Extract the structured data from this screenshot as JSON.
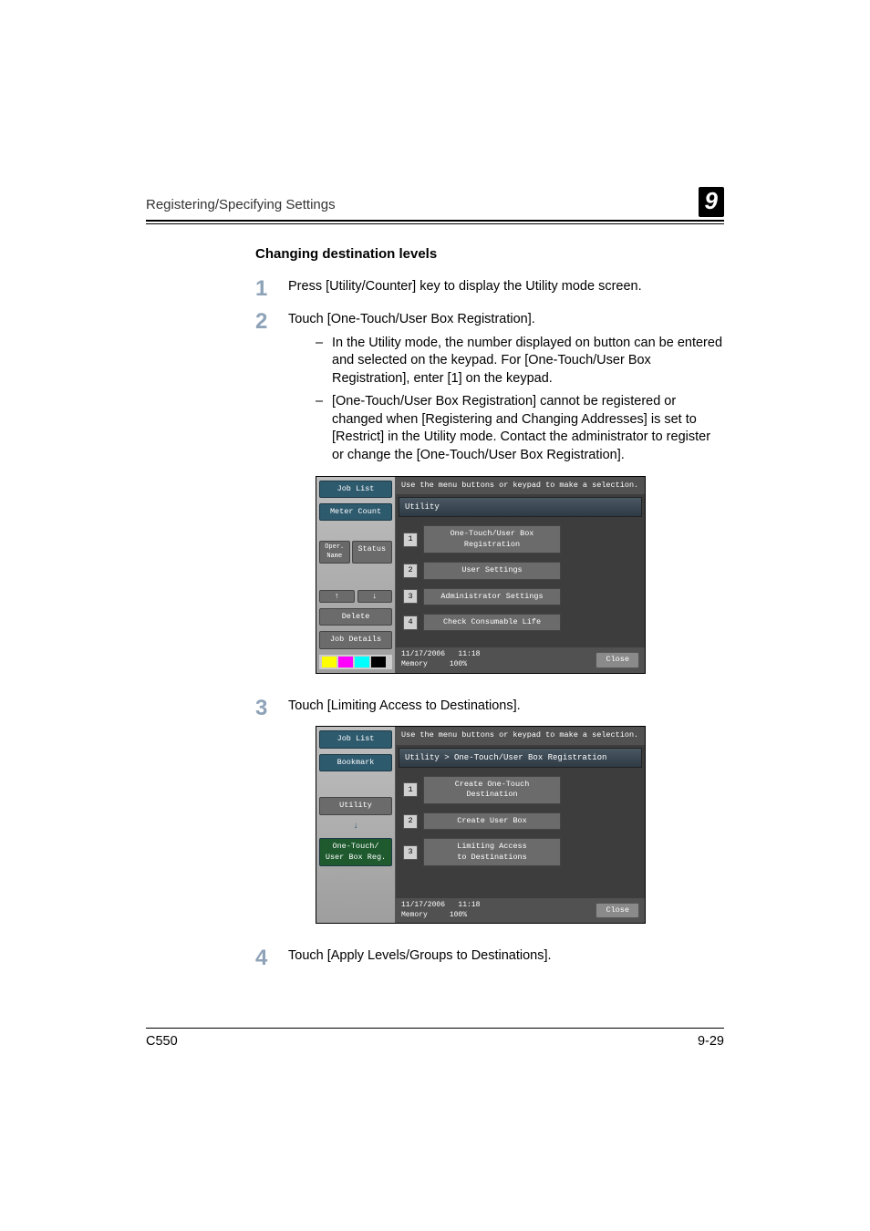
{
  "header": {
    "section": "Registering/Specifying Settings",
    "chapter": "9"
  },
  "title": "Changing destination levels",
  "steps": {
    "s1": {
      "n": "1",
      "text": "Press [Utility/Counter] key to display the Utility mode screen."
    },
    "s2": {
      "n": "2",
      "text": "Touch [One-Touch/User Box Registration].",
      "sub1": "In the Utility mode, the number displayed on button can be entered and selected on the keypad. For [One-Touch/User Box Registration], enter [1] on the keypad.",
      "sub2": "[One-Touch/User Box Registration] cannot be registered or changed when [Registering and Changing Addresses] is set to [Restrict] in the Utility mode. Contact the administrator to register or change the [One-Touch/User Box Registration]."
    },
    "s3": {
      "n": "3",
      "text": "Touch [Limiting Access to Destinations]."
    },
    "s4": {
      "n": "4",
      "text": "Touch [Apply Levels/Groups to Destinations]."
    }
  },
  "shot1": {
    "hint": "Use the menu buttons or keypad to make a selection.",
    "titlebar": "Utility",
    "side": {
      "joblist": "Job List",
      "meter": "Meter Count",
      "operlabel": "Oper.\nName",
      "status": "Status",
      "delete": "Delete",
      "jobdetails": "Job Details"
    },
    "opts": {
      "1": "One-Touch/User Box\nRegistration",
      "2": "User Settings",
      "3": "Administrator Settings",
      "4": "Check Consumable Life"
    },
    "close": "Close",
    "date": "11/17/2006",
    "time": "11:18",
    "memlabel": "Memory",
    "memval": "100%"
  },
  "shot2": {
    "hint": "Use the menu buttons or keypad to make a selection.",
    "titlebar": "Utility > One-Touch/User Box Registration",
    "side": {
      "joblist": "Job List",
      "bookmark": "Bookmark",
      "utility": "Utility",
      "onetouch": "One-Touch/\nUser Box Reg."
    },
    "opts": {
      "1": "Create One-Touch\nDestination",
      "2": "Create User Box",
      "3": "Limiting Access\nto Destinations"
    },
    "close": "Close",
    "date": "11/17/2006",
    "time": "11:18",
    "memlabel": "Memory",
    "memval": "100%"
  },
  "footer": {
    "model": "C550",
    "page": "9-29"
  },
  "dash": "–"
}
